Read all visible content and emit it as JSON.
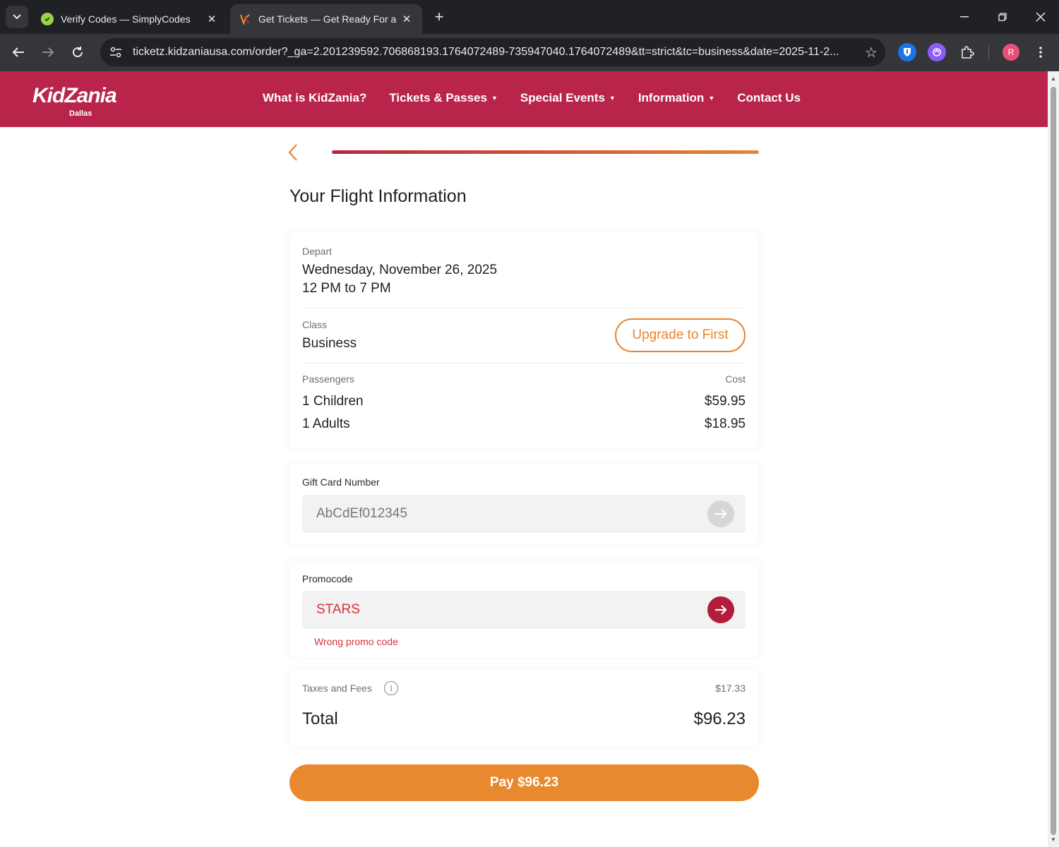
{
  "browser": {
    "tabs": [
      {
        "title": "Verify Codes — SimplyCodes",
        "active": false
      },
      {
        "title": "Get Tickets — Get Ready For a ",
        "active": true
      }
    ],
    "url": "ticketz.kidzaniausa.com/order?_ga=2.201239592.706868193.1764072489-735947040.1764072489&tt=strict&tc=business&date=2025-11-2...",
    "profile_initial": "R"
  },
  "site": {
    "logo": "KidZania",
    "logo_sub": "Dallas",
    "nav": [
      {
        "label": "What is KidZania?",
        "dropdown": false
      },
      {
        "label": "Tickets & Passes",
        "dropdown": true
      },
      {
        "label": "Special Events",
        "dropdown": true
      },
      {
        "label": "Information",
        "dropdown": true
      },
      {
        "label": "Contact Us",
        "dropdown": false
      }
    ],
    "brand_color": "#b9254a",
    "accent_color": "#e8892f"
  },
  "order": {
    "title": "Your Flight Information",
    "progress": 1.0,
    "depart_label": "Depart",
    "depart_date": "Wednesday, November 26, 2025",
    "depart_time": "12 PM to 7 PM",
    "class_label": "Class",
    "class_value": "Business",
    "upgrade_label": "Upgrade to First",
    "passengers_label": "Passengers",
    "cost_label": "Cost",
    "passengers": [
      {
        "label": "1 Children",
        "cost": "$59.95"
      },
      {
        "label": "1 Adults",
        "cost": "$18.95"
      }
    ]
  },
  "gift_card": {
    "label": "Gift Card Number",
    "placeholder": "AbCdEf012345"
  },
  "promo": {
    "label": "Promocode",
    "value": "STARS",
    "error": "Wrong promo code"
  },
  "totals": {
    "taxes_label": "Taxes and Fees",
    "taxes_value": "$17.33",
    "total_label": "Total",
    "total_value": "$96.23"
  },
  "pay_button": "Pay $96.23"
}
